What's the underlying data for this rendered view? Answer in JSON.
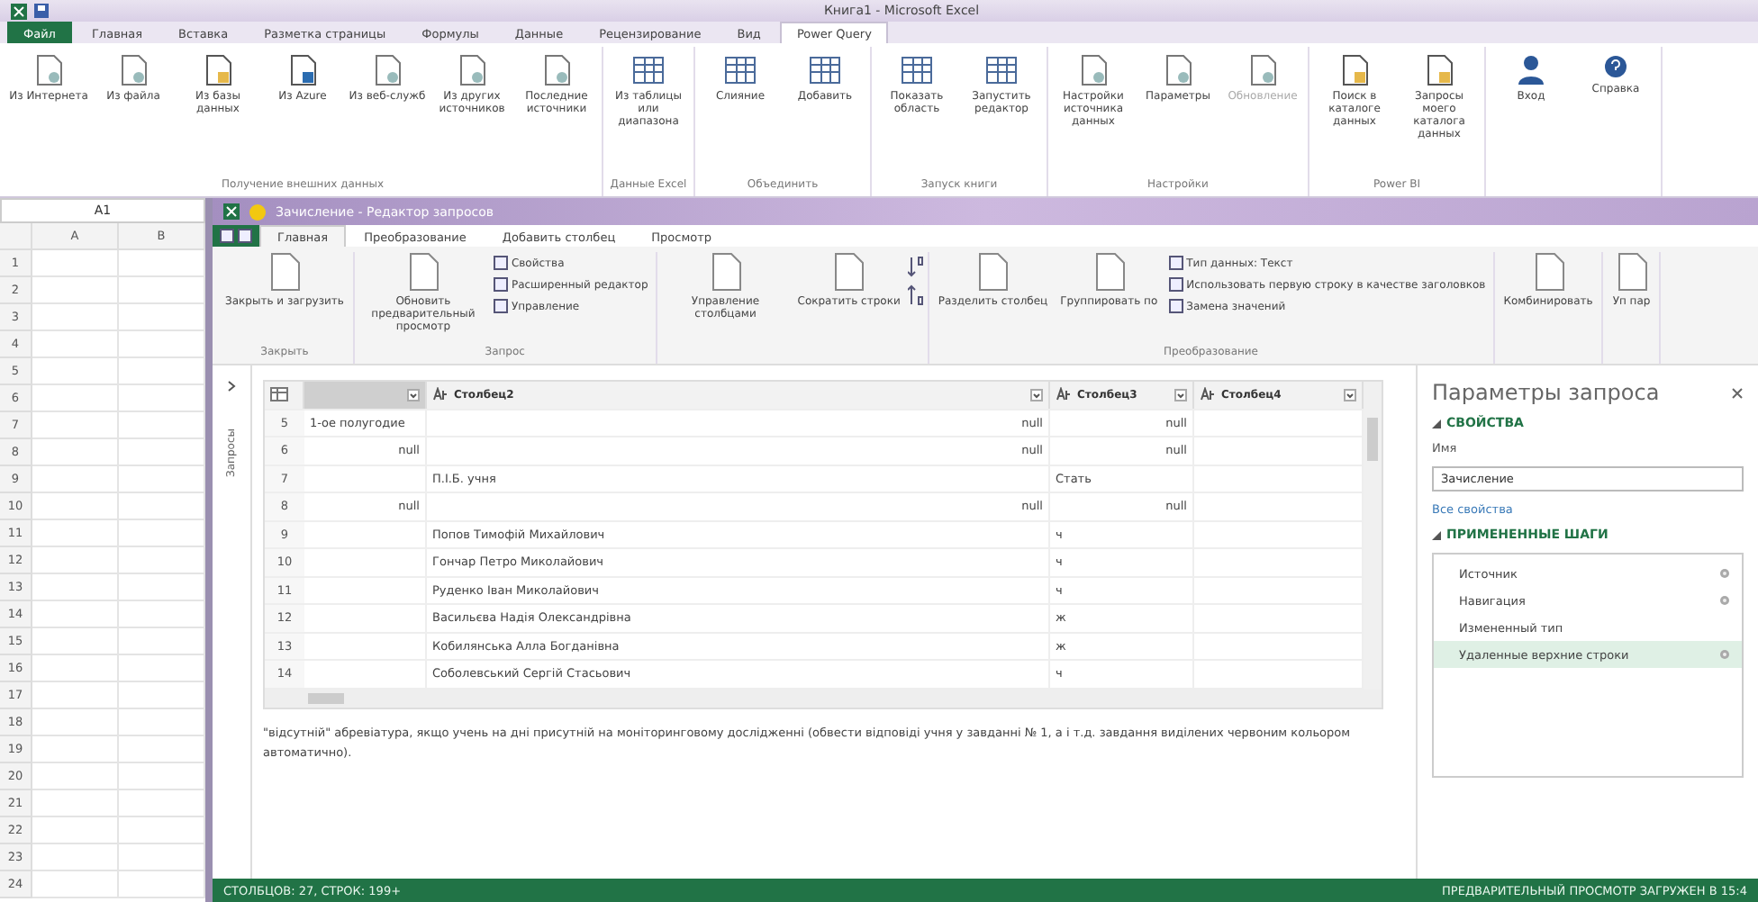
{
  "excel": {
    "title": "Книга1 - Microsoft Excel",
    "tabs": [
      {
        "label": "Файл",
        "selected": false,
        "kind": "file"
      },
      {
        "label": "Главная",
        "selected": false,
        "kind": "tab"
      },
      {
        "label": "Вставка",
        "selected": false,
        "kind": "tab"
      },
      {
        "label": "Разметка страницы",
        "selected": false,
        "kind": "tab"
      },
      {
        "label": "Формулы",
        "selected": false,
        "kind": "tab"
      },
      {
        "label": "Данные",
        "selected": false,
        "kind": "tab"
      },
      {
        "label": "Рецензирование",
        "selected": false,
        "kind": "tab"
      },
      {
        "label": "Вид",
        "selected": false,
        "kind": "tab"
      },
      {
        "label": "Power Query",
        "selected": true,
        "kind": "tab"
      }
    ],
    "ribbon_groups": [
      {
        "label": "Получение внешних данных",
        "buttons": [
          {
            "label": "Из Интернета",
            "disabled": false
          },
          {
            "label": "Из файла",
            "disabled": false
          },
          {
            "label": "Из базы данных",
            "disabled": false
          },
          {
            "label": "Из Azure",
            "disabled": false
          },
          {
            "label": "Из веб-служб",
            "disabled": false
          },
          {
            "label": "Из других источников",
            "disabled": false
          },
          {
            "label": "Последние источники",
            "disabled": false
          }
        ]
      },
      {
        "label": "Данные Excel",
        "buttons": [
          {
            "label": "Из таблицы или диапазона",
            "disabled": false
          }
        ]
      },
      {
        "label": "Объединить",
        "buttons": [
          {
            "label": "Слияние",
            "disabled": false
          },
          {
            "label": "Добавить",
            "disabled": false
          }
        ]
      },
      {
        "label": "Запуск книги",
        "buttons": [
          {
            "label": "Показать область",
            "disabled": false
          },
          {
            "label": "Запустить редактор",
            "disabled": false
          }
        ]
      },
      {
        "label": "Настройки",
        "buttons": [
          {
            "label": "Настройки источника данных",
            "disabled": false
          },
          {
            "label": "Параметры",
            "disabled": false
          },
          {
            "label": "Обновление",
            "disabled": true
          }
        ]
      },
      {
        "label": "Power BI",
        "buttons": [
          {
            "label": "Поиск в каталоге данных",
            "disabled": false
          },
          {
            "label": "Запросы моего каталога данных",
            "disabled": false
          }
        ]
      },
      {
        "buttons": [
          {
            "label": "Вход",
            "disabled": false
          },
          {
            "label": "Справка",
            "disabled": false
          }
        ]
      }
    ],
    "name_box": "A1",
    "columns": [
      "A",
      "B"
    ],
    "rows": [
      "1",
      "2",
      "3",
      "4",
      "5",
      "6",
      "7",
      "8",
      "9",
      "10",
      "11",
      "12",
      "13",
      "14",
      "15",
      "16",
      "17",
      "18",
      "19",
      "20",
      "21",
      "22",
      "23",
      "24"
    ]
  },
  "editor": {
    "title": "Зачисление - Редактор запросов",
    "tabs": [
      {
        "label": "Главная",
        "selected": true
      },
      {
        "label": "Преобразование",
        "selected": false
      },
      {
        "label": "Добавить столбец",
        "selected": false
      },
      {
        "label": "Просмотр",
        "selected": false
      }
    ],
    "ribbon_groups": [
      {
        "label": "Закрыть",
        "buttons": [
          {
            "kind": "large",
            "label": "Закрыть и загрузить"
          }
        ]
      },
      {
        "label": "Запрос",
        "buttons": [
          {
            "kind": "large",
            "label": "Обновить предварительный просмотр"
          },
          {
            "kind": "small",
            "label": "Свойства"
          },
          {
            "kind": "small",
            "label": "Расширенный редактор"
          },
          {
            "kind": "small",
            "label": "Управление"
          }
        ]
      },
      {
        "buttons": [
          {
            "kind": "large",
            "label": "Управление столбцами"
          },
          {
            "kind": "large",
            "label": "Сократить строки"
          },
          {
            "kind": "sort"
          }
        ]
      },
      {
        "label": "Преобразование",
        "buttons": [
          {
            "kind": "large",
            "label": "Разделить столбец"
          },
          {
            "kind": "large",
            "label": "Группировать по"
          },
          {
            "kind": "small",
            "label": "Тип данных: Текст"
          },
          {
            "kind": "small",
            "label": "Использовать первую строку в качестве заголовков"
          },
          {
            "kind": "small",
            "label": "Замена значений"
          }
        ]
      },
      {
        "buttons": [
          {
            "kind": "large",
            "label": "Комбинировать"
          }
        ]
      },
      {
        "buttons": [
          {
            "kind": "large",
            "label": "Уп пар"
          }
        ]
      }
    ],
    "nav_label": "Запросы",
    "table": {
      "columns": [
        null,
        "Столбец2",
        "Столбец3",
        "Столбец4"
      ],
      "rows": [
        {
          "index": "5",
          "cells": [
            {
              "text": "1-ое полугодие",
              "kind": "text"
            },
            {
              "text": "null",
              "kind": "null"
            },
            {
              "text": "null",
              "kind": "null"
            },
            null
          ]
        },
        {
          "index": "6",
          "cells": [
            {
              "text": "null",
              "kind": "null"
            },
            {
              "text": "null",
              "kind": "null"
            },
            {
              "text": "null",
              "kind": "null"
            },
            null
          ]
        },
        {
          "index": "7",
          "cells": [
            null,
            {
              "text": "П.І.Б. учня",
              "kind": "text"
            },
            {
              "text": "Стать",
              "kind": "text"
            },
            null
          ]
        },
        {
          "index": "8",
          "cells": [
            {
              "text": "null",
              "kind": "null"
            },
            {
              "text": "null",
              "kind": "null"
            },
            {
              "text": "null",
              "kind": "null"
            },
            null
          ]
        },
        {
          "index": "9",
          "cells": [
            null,
            {
              "text": "Попов Тимофій Михайлович",
              "kind": "text"
            },
            {
              "text": "ч",
              "kind": "text"
            },
            null
          ]
        },
        {
          "index": "10",
          "cells": [
            null,
            {
              "text": "Гончар Петро Миколайович",
              "kind": "text"
            },
            {
              "text": "ч",
              "kind": "text"
            },
            null
          ]
        },
        {
          "index": "11",
          "cells": [
            null,
            {
              "text": "Руденко Іван Миколайович",
              "kind": "text"
            },
            {
              "text": "ч",
              "kind": "text"
            },
            null
          ]
        },
        {
          "index": "12",
          "cells": [
            null,
            {
              "text": "Васильєва Надія Олександрівна",
              "kind": "text"
            },
            {
              "text": "ж",
              "kind": "text"
            },
            null
          ]
        },
        {
          "index": "13",
          "cells": [
            null,
            {
              "text": "Кобилянська Алла Богданівна",
              "kind": "text"
            },
            {
              "text": "ж",
              "kind": "text"
            },
            null
          ]
        },
        {
          "index": "14",
          "cells": [
            null,
            {
              "text": "Соболевський Сергій Стасьович",
              "kind": "text"
            },
            {
              "text": "ч",
              "kind": "text"
            },
            null
          ]
        }
      ]
    },
    "cell_detail": "\"відсутній\" абревіатура, якщо учень на дні присутній на моніторинговому дослідженні (обвести відповіді учня у завданні № 1, а і т.д. завдання виділених червоним кольором автоматично).",
    "pane": {
      "title": "Параметры запроса",
      "properties_heading": "СВОЙСТВА",
      "name_label": "Имя",
      "name_value": "Зачисление",
      "all_properties": "Все свойства",
      "steps_heading": "ПРИМЕНЕННЫЕ ШАГИ",
      "steps": [
        {
          "label": "Источник",
          "selected": false,
          "gear": true
        },
        {
          "label": "Навигация",
          "selected": false,
          "gear": true
        },
        {
          "label": "Измененный тип",
          "selected": false,
          "gear": false
        },
        {
          "label": "Удаленные верхние строки",
          "selected": true,
          "gear": true
        }
      ]
    },
    "status_left": "СТОЛБЦОВ: 27, СТРОК: 199+",
    "status_right": "ПРЕДВАРИТЕЛЬНЫЙ ПРОСМОТР ЗАГРУЖЕН В 15:4"
  }
}
